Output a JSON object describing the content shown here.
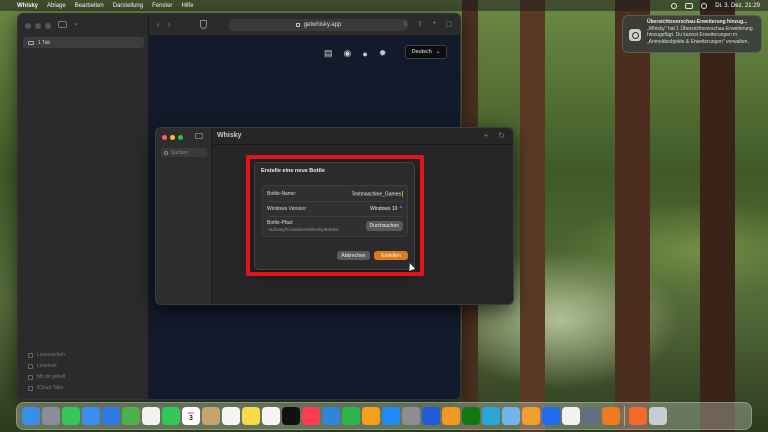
{
  "menubar": {
    "app_name": "Whisky",
    "items": [
      "Ablage",
      "Bearbeiten",
      "Darstellung",
      "Fenster",
      "Hilfe"
    ],
    "clock": "Di. 3. Dez.  21:29"
  },
  "safari": {
    "url": "getwhisky.app",
    "tab_label": "1 Tab",
    "sidebar_footer": [
      "Lesezeichen",
      "Leseliste",
      "Mit dir geteilt",
      "iCloud-Tabs"
    ],
    "language_select": "Deutsch"
  },
  "whisky": {
    "title": "Whisky",
    "search_placeholder": "Suchen"
  },
  "dialog": {
    "title": "Erstelle eine neue Bottle",
    "bottle_name_label": "Bottle-Name:",
    "bottle_name_value": "Textmaschine_Games",
    "windows_version_label": "Windows Version:",
    "windows_version_value": "Windows 10",
    "bottle_path_label": "Bottle-Pfad:",
    "bottle_path_value": "~/Library/Containers/Whisky/Bottles",
    "browse_button": "Durchsuchen",
    "cancel_button": "Abbrechen",
    "create_button": "Erstellen"
  },
  "notification": {
    "title": "Übersichtsvorschau-Erweiterung hinzug...",
    "body": "„Whisky\" hat 1 Übersichtsvorschau-Erweiterung hinzugefügt. Du kannst Erweiterungen in „Anmeldeobjekte & Erweiterungen\" verwalten."
  },
  "dock": {
    "calendar_month": "DEZ",
    "calendar_day": "3",
    "apps": [
      {
        "name": "finder",
        "color": "#3b8ee8"
      },
      {
        "name": "launchpad",
        "color": "#8a8f99"
      },
      {
        "name": "messages",
        "color": "#35c759"
      },
      {
        "name": "mail",
        "color": "#3d8ef0"
      },
      {
        "name": "safari",
        "color": "#2f7ae5"
      },
      {
        "name": "maps",
        "color": "#4db24b"
      },
      {
        "name": "photos",
        "color": "#f2f2f2"
      },
      {
        "name": "facetime",
        "color": "#34c759"
      },
      {
        "name": "calendar",
        "color": "#ffffff"
      },
      {
        "name": "contacts",
        "color": "#c5a470"
      },
      {
        "name": "reminders",
        "color": "#f5f5f5"
      },
      {
        "name": "notes",
        "color": "#f8d94a"
      },
      {
        "name": "freeform",
        "color": "#f5f5f5"
      },
      {
        "name": "tv",
        "color": "#111111"
      },
      {
        "name": "music",
        "color": "#fa3d52"
      },
      {
        "name": "keynote",
        "color": "#2f86d8"
      },
      {
        "name": "numbers",
        "color": "#2db54c"
      },
      {
        "name": "pages",
        "color": "#f3a21a"
      },
      {
        "name": "app-store",
        "color": "#1e8af5"
      },
      {
        "name": "system-settings",
        "color": "#8e8e93"
      },
      {
        "name": "xcode-like",
        "color": "#1f5bd6"
      },
      {
        "name": "pencil-app",
        "color": "#f09a22"
      },
      {
        "name": "xbox-like",
        "color": "#0f7b0f"
      },
      {
        "name": "dolphin-like",
        "color": "#2aa7d8"
      },
      {
        "name": "playstation-like",
        "color": "#74b3e8"
      },
      {
        "name": "game-app",
        "color": "#f0a030"
      },
      {
        "name": "testflight",
        "color": "#1f6cf0"
      },
      {
        "name": "textedit",
        "color": "#f2f2f2"
      },
      {
        "name": "utility",
        "color": "#606e80"
      },
      {
        "name": "tool-orange",
        "color": "#f07a22"
      },
      {
        "name": "downloads",
        "color": "#f26b2a"
      },
      {
        "name": "trash",
        "color": "#c9cdd2"
      }
    ]
  },
  "colors": {
    "accent": "#d97b1e",
    "highlight": "#e0141a"
  }
}
